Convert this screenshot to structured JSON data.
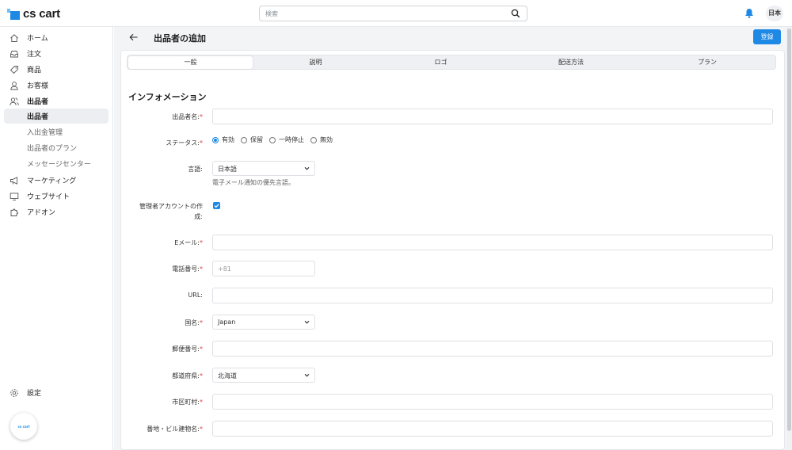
{
  "header": {
    "logo_text": "cs cart",
    "search_placeholder": "検索",
    "language": "日本"
  },
  "sidebar": {
    "items": [
      {
        "label": "ホーム",
        "icon": "home-icon"
      },
      {
        "label": "注文",
        "icon": "inbox-icon"
      },
      {
        "label": "商品",
        "icon": "tag-icon"
      },
      {
        "label": "お客様",
        "icon": "user-icon"
      },
      {
        "label": "出品者",
        "icon": "users-icon"
      }
    ],
    "sub_items": [
      {
        "label": "出品者",
        "active": true
      },
      {
        "label": "入出金管理",
        "active": false
      },
      {
        "label": "出品者のプラン",
        "active": false
      },
      {
        "label": "メッセージセンター",
        "active": false
      }
    ],
    "more_items": [
      {
        "label": "マーケティング",
        "icon": "megaphone-icon"
      },
      {
        "label": "ウェブサイト",
        "icon": "monitor-icon"
      },
      {
        "label": "アドオン",
        "icon": "puzzle-icon"
      }
    ],
    "settings_label": "設定",
    "store_badge_text": "cs cart"
  },
  "page": {
    "title": "出品者の追加",
    "save_label": "登録"
  },
  "tabs": [
    "一般",
    "説明",
    "ロゴ",
    "配送方法",
    "プラン"
  ],
  "section_title": "インフォメーション",
  "form": {
    "name_label": "出品者名:",
    "status_label": "ステータス:",
    "status_options": [
      "有効",
      "保留",
      "一時停止",
      "無効"
    ],
    "status_selected": "有効",
    "language_label": "言語:",
    "language_value": "日本語",
    "language_help": "電子メール通知の優先言語。",
    "create_account_label_1": "管理者アカウントの作",
    "create_account_label_2": "成:",
    "create_account_checked": true,
    "email_label": "Eメール:",
    "phone_label": "電話番号:",
    "phone_placeholder": "+81",
    "url_label": "URL:",
    "country_label": "国名:",
    "country_value": "Japan",
    "zip_label": "郵便番号:",
    "state_label": "都道府県:",
    "state_value": "北海道",
    "city_label": "市区町村:",
    "address_label": "番地・ビル建物名:",
    "required_mark": "*"
  },
  "colors": {
    "accent": "#1e88e5",
    "required": "#e53935"
  }
}
